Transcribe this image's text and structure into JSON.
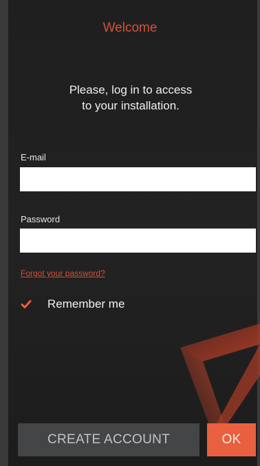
{
  "header": {
    "title": "Welcome"
  },
  "intro": {
    "text": "Please, log in to access\nto your installation."
  },
  "form": {
    "email_label": "E-mail",
    "email_value": "",
    "password_label": "Password",
    "password_value": "",
    "forgot_link": "Forgot your password?",
    "remember_label": "Remember me",
    "remember_checked": true
  },
  "actions": {
    "create_account_label": "CREATE ACCOUNT",
    "ok_label": "OK"
  },
  "colors": {
    "accent": "#e8603f",
    "title": "#d0533a",
    "background": "#202020",
    "secondary_button": "#444547"
  },
  "icons": {
    "checkbox": "checkmark-icon",
    "logo": "play-triangle-logo"
  }
}
